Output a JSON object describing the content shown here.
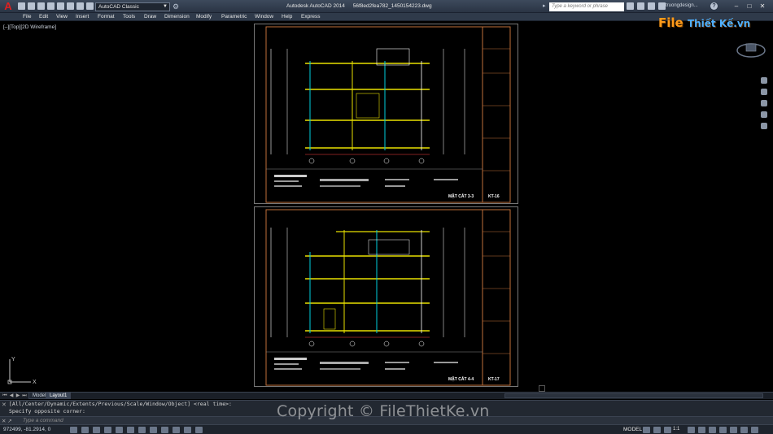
{
  "app": {
    "title": "Autodesk AutoCAD 2014",
    "filename": "56f8ed2fea782_1450154223.dwg",
    "workspace": "AutoCAD Classic",
    "search_placeholder": "Type a keyword or phrase",
    "user": "truongdesign...",
    "help": "?"
  },
  "menu": [
    "File",
    "Edit",
    "View",
    "Insert",
    "Format",
    "Tools",
    "Draw",
    "Dimension",
    "Modify",
    "Parametric",
    "Window",
    "Help",
    "Express"
  ],
  "viewport_label": "[–][Top][2D Wireframe]",
  "watermark": {
    "logo_main": "File",
    "logo_rest": "Thiết Kế.vn",
    "copyright": "Copyright © FileThietKe.vn"
  },
  "ucs": {
    "x_label": "X",
    "y_label": "Y"
  },
  "sheets": [
    {
      "title_label": "MẶT CẮT 3-3",
      "code": "KT-16"
    },
    {
      "title_label": "MẶT CẮT 4-4",
      "code": "KT-17"
    }
  ],
  "tabs": {
    "model": "Model",
    "layout1": "Layout1"
  },
  "command": {
    "history_1": "[All/Center/Dynamic/Extents/Previous/Scale/Window/Object] <real time>:",
    "history_2": "Specify opposite corner:",
    "prompt_placeholder": "Type a command",
    "icons": "✕ ↗"
  },
  "status": {
    "coords": "972499, -81.2914, 0",
    "mode": "MODEL",
    "scale": "1:1"
  },
  "colors": {
    "titlebar": "#2f3a4a",
    "accent_logo": "#e02020",
    "sheet_border": "#c0703a",
    "floor_yellow": "#e8e000",
    "wall_cyan": "#00d0e0",
    "dim_white": "#ffffff"
  }
}
